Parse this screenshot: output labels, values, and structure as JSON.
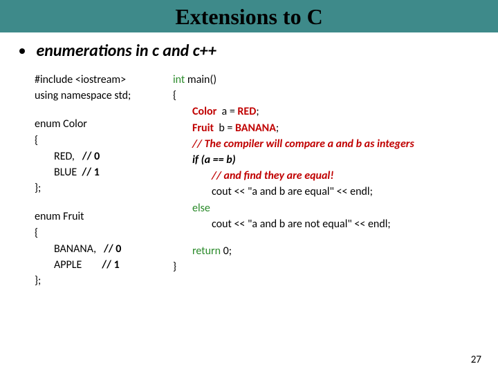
{
  "title": "Extensions to C",
  "subtitle": "enumerations in c and c++",
  "left": {
    "inc1": "#include <iostream>",
    "inc2": "using namespace std;",
    "enum1_head": "enum Color",
    "open": "{",
    "enum1_r": "RED,   ",
    "enum1_r_c": "// 0",
    "enum1_b": "BLUE  ",
    "enum1_b_c": "// 1",
    "close": "};",
    "enum2_head": "enum Fruit",
    "enum2_ban": "BANANA,   ",
    "enum2_ban_c": "// 0",
    "enum2_app": "APPLE        ",
    "enum2_app_c": "// 1"
  },
  "right": {
    "main_sig_kw": "int",
    "main_sig_rest": " main()",
    "open": "{",
    "l1_type": "Color",
    "l1_mid": "  a = ",
    "l1_val": "RED",
    "semi": ";",
    "l2_type": "Fruit",
    "l2_mid": "  b = ",
    "l2_val": "BANANA",
    "c1": "// The compiler will compare a and b as integers",
    "if_kw": "if",
    "if_cond": " (a == b)",
    "c2": "// and find they are equal!",
    "cout1": "cout << \"a and b are equal\" << endl;",
    "else_kw": "else",
    "cout2": "cout << \"a and b are not equal\" << endl;",
    "ret_kw": "return",
    "ret_rest": " 0;",
    "close": "}"
  },
  "page": "27"
}
